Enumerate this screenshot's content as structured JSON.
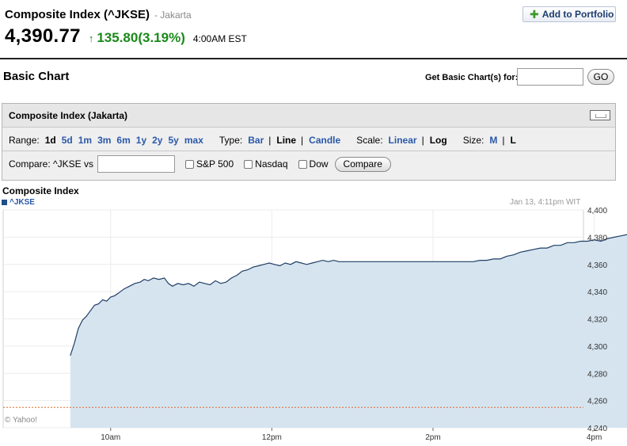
{
  "quote": {
    "title": "Composite Index (^JKSE)",
    "exchange": "- Jakarta",
    "price": "4,390.77",
    "change_arrow": "↑",
    "change": "135.80(3.19%)",
    "time": "4:00AM EST",
    "add_portfolio_label": "Add to Portfolio",
    "up_color": "#1a8a1a"
  },
  "basic_chart": {
    "title": "Basic Chart",
    "get_label": "Get Basic Chart(s) for:",
    "get_input_value": "",
    "go_label": "GO"
  },
  "panel": {
    "title": "Composite Index (Jakarta)",
    "range_label": "Range:",
    "ranges": [
      "1d",
      "5d",
      "1m",
      "3m",
      "6m",
      "1y",
      "2y",
      "5y",
      "max"
    ],
    "range_selected": "1d",
    "type_label": "Type:",
    "types": [
      "Bar",
      "Line",
      "Candle"
    ],
    "type_selected": "Line",
    "scale_label": "Scale:",
    "scales": [
      "Linear",
      "Log"
    ],
    "scale_selected": "Log",
    "size_label": "Size:",
    "sizes": [
      "M",
      "L"
    ],
    "size_selected": "L",
    "compare_label": "Compare: ^JKSE vs",
    "compare_input_value": "",
    "compare_options": [
      "S&P 500",
      "Nasdaq",
      "Dow"
    ],
    "compare_button": "Compare"
  },
  "chart": {
    "title": "Composite Index",
    "legend": "^JKSE",
    "timestamp": "Jan 13, 4:11pm WIT",
    "copyright": "© Yahoo!",
    "line_color": "#1f3f66",
    "fill_color": "#d6e4ef",
    "prev_close_color": "#e06a2a"
  },
  "chart_data": {
    "type": "area",
    "title": "Composite Index",
    "series": [
      {
        "name": "^JKSE"
      }
    ],
    "x_tick_labels": [
      "10am",
      "12pm",
      "2pm",
      "4pm"
    ],
    "y_tick_labels": [
      "4,400",
      "4,380",
      "4,360",
      "4,340",
      "4,320",
      "4,300",
      "4,280",
      "4,260",
      "4,240"
    ],
    "ylim": [
      4240,
      4400
    ],
    "x_domain_minutes": [
      -50,
      382
    ],
    "previous_close": 4254.97,
    "points": [
      [
        0,
        4293
      ],
      [
        3,
        4302
      ],
      [
        6,
        4313
      ],
      [
        9,
        4319
      ],
      [
        12,
        4322
      ],
      [
        15,
        4326
      ],
      [
        18,
        4330
      ],
      [
        21,
        4331
      ],
      [
        24,
        4334
      ],
      [
        27,
        4333
      ],
      [
        30,
        4336
      ],
      [
        33,
        4337
      ],
      [
        36,
        4339
      ],
      [
        40,
        4342
      ],
      [
        44,
        4344
      ],
      [
        48,
        4346
      ],
      [
        52,
        4347
      ],
      [
        55,
        4349
      ],
      [
        58,
        4348
      ],
      [
        62,
        4350
      ],
      [
        66,
        4349
      ],
      [
        70,
        4350
      ],
      [
        73,
        4346
      ],
      [
        76,
        4344
      ],
      [
        80,
        4346
      ],
      [
        84,
        4345
      ],
      [
        88,
        4346
      ],
      [
        92,
        4344
      ],
      [
        96,
        4347
      ],
      [
        100,
        4346
      ],
      [
        104,
        4345
      ],
      [
        108,
        4348
      ],
      [
        112,
        4346
      ],
      [
        116,
        4347
      ],
      [
        120,
        4350
      ],
      [
        124,
        4352
      ],
      [
        128,
        4355
      ],
      [
        132,
        4356
      ],
      [
        136,
        4358
      ],
      [
        140,
        4359
      ],
      [
        144,
        4360
      ],
      [
        148,
        4361
      ],
      [
        152,
        4360
      ],
      [
        156,
        4359
      ],
      [
        160,
        4361
      ],
      [
        164,
        4360
      ],
      [
        168,
        4362
      ],
      [
        172,
        4361
      ],
      [
        176,
        4360
      ],
      [
        180,
        4361
      ],
      [
        184,
        4362
      ],
      [
        188,
        4363
      ],
      [
        192,
        4362
      ],
      [
        196,
        4363
      ],
      [
        200,
        4362
      ],
      [
        203,
        4362
      ],
      [
        205,
        4362
      ],
      [
        230,
        4362
      ],
      [
        255,
        4362
      ],
      [
        280,
        4362
      ],
      [
        290,
        4362
      ],
      [
        300,
        4362
      ],
      [
        305,
        4363
      ],
      [
        310,
        4363
      ],
      [
        315,
        4364
      ],
      [
        320,
        4364
      ],
      [
        325,
        4366
      ],
      [
        330,
        4367
      ],
      [
        335,
        4369
      ],
      [
        340,
        4370
      ],
      [
        345,
        4371
      ],
      [
        350,
        4372
      ],
      [
        355,
        4372
      ],
      [
        360,
        4374
      ],
      [
        365,
        4374
      ],
      [
        370,
        4376
      ],
      [
        375,
        4376
      ],
      [
        380,
        4377
      ],
      [
        385,
        4377
      ],
      [
        390,
        4378
      ],
      [
        395,
        4377
      ],
      [
        400,
        4379
      ],
      [
        405,
        4380
      ],
      [
        410,
        4381
      ],
      [
        415,
        4382
      ],
      [
        420,
        4383
      ],
      [
        425,
        4384
      ],
      [
        430,
        4385
      ],
      [
        435,
        4385
      ],
      [
        440,
        4386
      ],
      [
        445,
        4387
      ],
      [
        450,
        4388
      ],
      [
        455,
        4387
      ],
      [
        460,
        4389
      ],
      [
        465,
        4388
      ],
      [
        470,
        4389
      ],
      [
        475,
        4390
      ],
      [
        480,
        4390
      ],
      [
        485,
        4391
      ],
      [
        490,
        4390
      ],
      [
        495,
        4391
      ],
      [
        500,
        4390
      ],
      [
        505,
        4391
      ],
      [
        510,
        4390
      ]
    ]
  }
}
